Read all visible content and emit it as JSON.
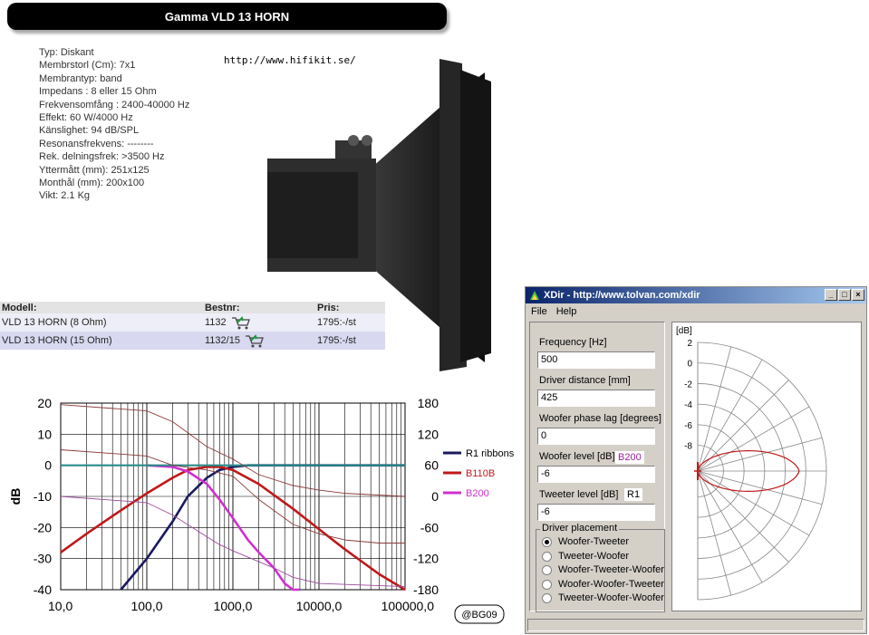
{
  "page": {
    "title": "Gamma VLD 13 HORN",
    "site_url": "http://www.hifikit.se/"
  },
  "specs": [
    "Typ: Diskant",
    "Membrstorl (Cm): 7x1",
    "Membrantyp: band",
    "Impedans : 8 eller 15 Ohm",
    "Frekvensomfång : 2400-40000 Hz",
    "Effekt: 60 W/4000 Hz",
    "Känslighet: 94 dB/SPL",
    "Resonansfrekvens: --------",
    "Rek. delningsfrek: >3500 Hz",
    "Yttermått (mm): 251x125",
    "Monthål (mm): 200x100",
    "Vikt: 2.1 Kg"
  ],
  "product_table": {
    "headers": [
      "Modell:",
      "Bestnr:",
      "Pris:"
    ],
    "rows": [
      {
        "model": "VLD 13 HORN (8 Ohm)",
        "nr": "1132",
        "price": "1795:-/st"
      },
      {
        "model": "VLD 13 HORN (15 Ohm)",
        "nr": "1132/15",
        "price": "1795:-/st"
      }
    ]
  },
  "chart_data": {
    "type": "line",
    "xscale": "log",
    "xlim": [
      10,
      100000
    ],
    "ylim": [
      -40,
      20
    ],
    "y2lim": [
      -180,
      180
    ],
    "ylabel": "dB",
    "xticks": [
      "10,0",
      "100,0",
      "1000,0",
      "10000,0",
      "100000,0"
    ],
    "yticks": [
      "20",
      "10",
      "0",
      "-10",
      "-20",
      "-30",
      "-40"
    ],
    "y2ticks": [
      "180",
      "120",
      "60",
      "0",
      "-60",
      "-120",
      "-180"
    ],
    "grid": true,
    "legend_position": "right",
    "badge": "@BG09",
    "series": [
      {
        "name": "R1 ribbons",
        "color": "#1a1a5e",
        "x": [
          50,
          100,
          200,
          300,
          500,
          700,
          1000,
          1500,
          2000,
          5000,
          100000
        ],
        "y": [
          -40,
          -30,
          -18,
          -10,
          -4,
          -1.5,
          -0.5,
          0,
          0,
          0,
          0
        ]
      },
      {
        "name": "B110B",
        "color": "#c0181a",
        "x": [
          10,
          20,
          50,
          100,
          200,
          300,
          500,
          700,
          1000,
          2000,
          5000,
          10000,
          20000,
          50000,
          100000
        ],
        "y": [
          -28,
          -22,
          -14.5,
          -9,
          -4,
          -1.5,
          -0.5,
          -0.5,
          -1.5,
          -6,
          -14,
          -20.5,
          -27,
          -35,
          -40
        ]
      },
      {
        "name": "B200",
        "color": "#d030d0",
        "x": [
          100,
          200,
          300,
          500,
          700,
          1000,
          1500,
          2000,
          3000,
          4000,
          5000,
          6000
        ],
        "y": [
          0,
          -0.5,
          -2,
          -6,
          -11,
          -17,
          -24,
          -28,
          -33,
          -38,
          -40,
          -40
        ]
      },
      {
        "name": "",
        "color": "#2a8a8a",
        "x": [
          10,
          100000
        ],
        "y": [
          0,
          0
        ]
      },
      {
        "name": "",
        "color": "#8a3a3a",
        "x": [
          10,
          100,
          200,
          500,
          1000,
          2000,
          5000,
          10000,
          20000,
          100000
        ],
        "y": [
          19.5,
          17.5,
          14,
          6,
          2,
          -3,
          -6.5,
          -8,
          -9,
          -10
        ]
      },
      {
        "name": "",
        "color": "#8a3a3a",
        "x": [
          10,
          100,
          200,
          500,
          1000,
          2000,
          5000,
          10000,
          20000,
          50000,
          100000
        ],
        "y": [
          5,
          3,
          0,
          -1.5,
          -3.5,
          -11,
          -19,
          -22,
          -24,
          -25,
          -25
        ]
      },
      {
        "name": "",
        "color": "#9a4a9a",
        "x": [
          10,
          100,
          200,
          500,
          700,
          1000,
          2000,
          3000,
          5000,
          10000,
          100000
        ],
        "y": [
          -10,
          -12,
          -16,
          -23,
          -25.5,
          -27.5,
          -31,
          -33,
          -36,
          -38,
          -39
        ]
      }
    ]
  },
  "xdir": {
    "title": "XDir - http://www.tolvan.com/xdir",
    "menu": [
      "File",
      "Help"
    ],
    "fields": [
      {
        "label": "Frequency [Hz]",
        "value": "500"
      },
      {
        "label": "Driver distance [mm]",
        "value": "425"
      },
      {
        "label": "Woofer phase lag [degrees]",
        "value": "0"
      },
      {
        "label": "Woofer level [dB]",
        "value": "-6",
        "tag": "B200"
      },
      {
        "label": "Tweeter level [dB]",
        "value": "-6",
        "tag": "R1"
      }
    ],
    "placement_label": "Driver placement",
    "placement_options": [
      {
        "label": "Woofer-Tweeter",
        "selected": true
      },
      {
        "label": "Tweeter-Woofer",
        "selected": false
      },
      {
        "label": "Woofer-Tweeter-Woofer",
        "selected": false
      },
      {
        "label": "Woofer-Woofer-Tweeter",
        "selected": false
      },
      {
        "label": "Tweeter-Woofer-Woofer",
        "selected": false
      }
    ],
    "polar": {
      "unit": "[dB]",
      "ticks": [
        "2",
        "0",
        "-2",
        "-4",
        "-6",
        "-8"
      ]
    }
  },
  "colors": {
    "title_bg": "#000000",
    "table_row_alt": "#d8d8f0",
    "xdir_title": "#0a246a",
    "polar_curve": "#c0181a",
    "tag_b200": "#a020a0"
  }
}
